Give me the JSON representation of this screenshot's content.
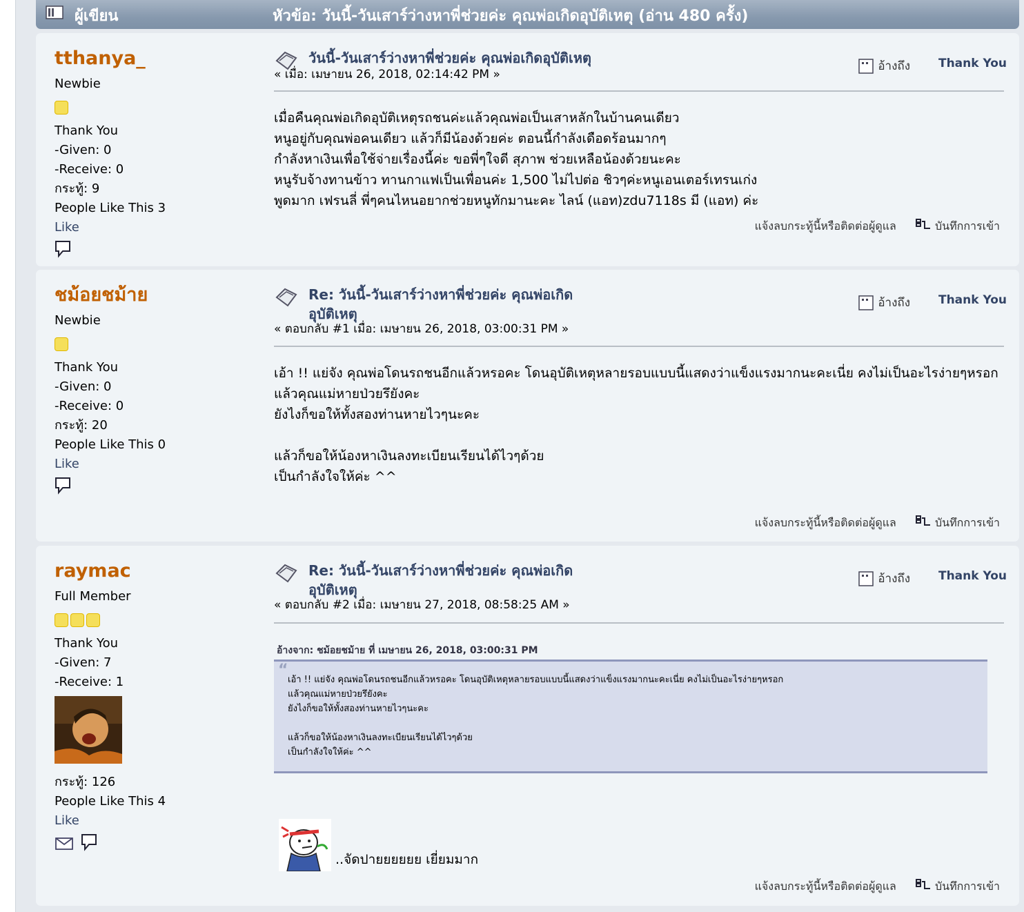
{
  "header": {
    "author_label": "ผู้เขียน",
    "topic_label": "หัวข้อ: วันนี้-วันเสาร์ว่างหาพี่ช่วยค่ะ คุณพ่อเกิดอุบัติเหตุ  (อ่าน 480 ครั้ง)"
  },
  "actions": {
    "quote": "อ้างถึง",
    "thank_you": "Thank You"
  },
  "footer": {
    "report": "แจ้งลบกระทู้นี้หรือติดต่อผู้ดูแล",
    "log": "บันทึกการเข้า"
  },
  "posts": [
    {
      "name": "tthanya_",
      "group": "Newbie",
      "thank_you": "Thank You",
      "given": "-Given: 0",
      "receive": "-Receive: 0",
      "posts": "กระทู้: 9",
      "people_like": "People Like This 3",
      "like": "Like",
      "subject": "วันนี้-วันเสาร์ว่างหาพี่ช่วยค่ะ คุณพ่อเกิดอุบัติเหตุ",
      "meta": "« เมื่อ: เมษายน 26, 2018, 02:14:42 PM »",
      "body": [
        "เมื่อคืนคุณพ่อเกิดอุบัติเหตุรถชนค่ะแล้วคุณพ่อเป็นเสาหลักในบ้านคนเดียว",
        "หนูอยู่กับคุณพ่อคนเดียว แล้วก็มีน้องด้วยค่ะ ตอนนี้กำลังเดือดร้อนมากๆ",
        "กำลังหาเงินเพื่อใช้จ่ายเรื่องนี้ค่ะ ขอพี่ๆใจดี สุภาพ ช่วยเหลือน้องด้วยนะคะ",
        "หนูรับจ้างทานข้าว ทานกาแฟเป็นเพื่อนค่ะ 1,500 ไม่ไปต่อ ชิวๆค่ะหนูเอนเตอร์เทรนเก่ง",
        "พูดมาก เฟรนลี่ พี่ๆคนไหนอยากช่วยหนูทักมานะคะ ไลน์ (แอท)zdu7118s มี (แอท) ค่ะ"
      ]
    },
    {
      "name": "ชม้อยชม้าย",
      "group": "Newbie",
      "thank_you": "Thank You",
      "given": "-Given: 0",
      "receive": "-Receive: 0",
      "posts": "กระทู้: 20",
      "people_like": "People Like This 0",
      "like": "Like",
      "subject": "Re: วันนี้-วันเสาร์ว่างหาพี่ช่วยค่ะ คุณพ่อเกิดอุบัติเหตุ",
      "meta": "« ตอบกลับ #1 เมื่อ: เมษายน 26, 2018, 03:00:31 PM »",
      "body": [
        "เอ้า !! แย่จัง คุณพ่อโดนรถชนอีกแล้วหรอคะ โดนอุบัติเหตุหลายรอบแบบนี้แสดงว่าแข็งแรงมากนะคะเนี่ย คงไม่เป็นอะไรง่ายๆหรอก",
        "แล้วคุณแม่หายป่วยรึยังคะ",
        "ยังไงก็ขอให้ทั้งสองท่านหายไวๆนะคะ",
        "",
        "แล้วก็ขอให้น้องหาเงินลงทะเบียนเรียนได้ไวๆด้วย",
        "เป็นกำลังใจให้ค่ะ  ^^"
      ]
    },
    {
      "name": "raymac",
      "group": "Full Member",
      "thank_you": "Thank You",
      "given": "-Given: 7",
      "receive": "-Receive: 1",
      "posts": "กระทู้: 126",
      "people_like": "People Like This 4",
      "like": "Like",
      "subject": "Re: วันนี้-วันเสาร์ว่างหาพี่ช่วยค่ะ คุณพ่อเกิดอุบัติเหตุ",
      "meta": "« ตอบกลับ #2 เมื่อ: เมษายน 27, 2018, 08:58:25 AM »",
      "quote_header": "อ้างจาก: ชม้อยชม้าย ที่ เมษายน 26, 2018, 03:00:31 PM",
      "quote_lines": [
        "เอ้า !! แย่จัง คุณพ่อโดนรถชนอีกแล้วหรอคะ โดนอุบัติเหตุหลายรอบแบบนี้แสดงว่าแข็งแรงมากนะคะเนี่ย คงไม่เป็นอะไรง่ายๆหรอก",
        "แล้วคุณแม่หายป่วยรึยังคะ",
        "ยังไงก็ขอให้ทั้งสองท่านหายไวๆนะคะ",
        "",
        "แล้วก็ขอให้น้องหาเงินลงทะเบียนเรียนได้ไวๆด้วย",
        "เป็นกำลังใจให้ค่ะ  ^^"
      ],
      "signature": "..จัดปายยยยยย เยี่ยมมาก"
    }
  ]
}
